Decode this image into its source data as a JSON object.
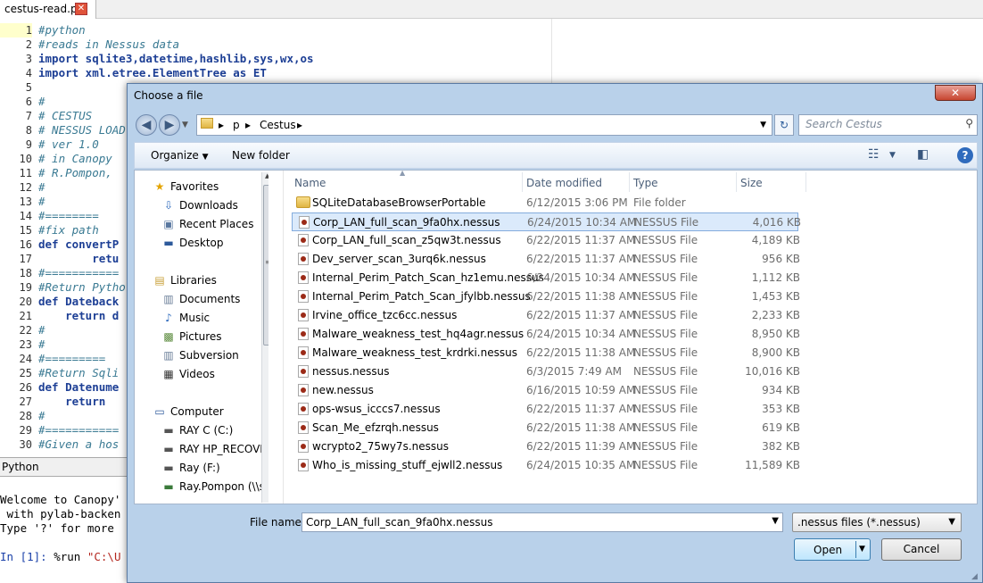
{
  "editor": {
    "tab_label": "cestus-read.py",
    "close_glyph": "✕",
    "lines": [
      {
        "n": "1",
        "text": "#python",
        "kind": "cm"
      },
      {
        "n": "2",
        "text": "#reads in Nessus data",
        "kind": "cm"
      },
      {
        "n": "3",
        "text": "import sqlite3,datetime,hashlib,sys,wx,os",
        "kind": "kw"
      },
      {
        "n": "4",
        "text": "import xml.etree.ElementTree as ET",
        "kind": "kw"
      },
      {
        "n": "5",
        "text": "",
        "kind": "cm"
      },
      {
        "n": "6",
        "text": "#",
        "kind": "cm"
      },
      {
        "n": "7",
        "text": "# CESTUS",
        "kind": "cm"
      },
      {
        "n": "8",
        "text": "# NESSUS LOAD",
        "kind": "cm"
      },
      {
        "n": "9",
        "text": "# ver 1.0",
        "kind": "cm"
      },
      {
        "n": "10",
        "text": "# in Canopy",
        "kind": "cm"
      },
      {
        "n": "11",
        "text": "# R.Pompon,",
        "kind": "cm"
      },
      {
        "n": "12",
        "text": "#",
        "kind": "cm"
      },
      {
        "n": "13",
        "text": "#",
        "kind": "cm"
      },
      {
        "n": "14",
        "text": "#========",
        "kind": "cm"
      },
      {
        "n": "15",
        "text": "#fix path",
        "kind": "cm"
      },
      {
        "n": "16",
        "text": "def convertP",
        "kind": "kw"
      },
      {
        "n": "17",
        "text": "        retu",
        "kind": "kw"
      },
      {
        "n": "18",
        "text": "#===========",
        "kind": "cm"
      },
      {
        "n": "19",
        "text": "#Return Pytho",
        "kind": "cm"
      },
      {
        "n": "20",
        "text": "def Dateback",
        "kind": "kw"
      },
      {
        "n": "21",
        "text": "    return d",
        "kind": "kw"
      },
      {
        "n": "22",
        "text": "#",
        "kind": "cm"
      },
      {
        "n": "23",
        "text": "#",
        "kind": "cm"
      },
      {
        "n": "24",
        "text": "#=========",
        "kind": "cm"
      },
      {
        "n": "25",
        "text": "#Return Sqli",
        "kind": "cm"
      },
      {
        "n": "26",
        "text": "def Datenume",
        "kind": "kw"
      },
      {
        "n": "27",
        "text": "    return",
        "kind": "kw"
      },
      {
        "n": "28",
        "text": "#",
        "kind": "cm"
      },
      {
        "n": "29",
        "text": "#===========",
        "kind": "cm"
      },
      {
        "n": "30",
        "text": "#Given a hos",
        "kind": "cm"
      }
    ]
  },
  "console": {
    "tab_label": "Python",
    "line1": "Welcome to Canopy'",
    "line2": " with pylab-backen",
    "line3": "Type '?' for more ",
    "prompt": "In [1]: ",
    "cmd": "%run ",
    "arg": "\"C:\\U"
  },
  "dialog": {
    "title": "Choose a file",
    "close_glyph": "✕",
    "address": {
      "crumb1": "p",
      "crumb2": "Cestus",
      "sep": "▸"
    },
    "search_placeholder": "Search Cestus",
    "toolbar": {
      "organize": "Organize",
      "new_folder": "New folder",
      "help": "?"
    },
    "nav": {
      "favorites": "Favorites",
      "downloads": "Downloads",
      "recent": "Recent Places",
      "desktop": "Desktop",
      "libraries": "Libraries",
      "documents": "Documents",
      "music": "Music",
      "pictures": "Pictures",
      "subversion": "Subversion",
      "videos": "Videos",
      "computer": "Computer",
      "ray_c": "RAY C (C:)",
      "ray_hp": "RAY HP_RECOVE",
      "ray_f": "Ray (F:)",
      "ray_pompon": "Ray.Pompon (\\\\s"
    },
    "columns": {
      "name": "Name",
      "date": "Date modified",
      "type": "Type",
      "size": "Size"
    },
    "files": [
      {
        "name": "SQLiteDatabaseBrowserPortable",
        "date": "6/12/2015 3:06 PM",
        "type": "File folder",
        "size": ""
      },
      {
        "name": "Corp_LAN_full_scan_9fa0hx.nessus",
        "date": "6/24/2015 10:34 AM",
        "type": "NESSUS File",
        "size": "4,016 KB"
      },
      {
        "name": "Corp_LAN_full_scan_z5qw3t.nessus",
        "date": "6/22/2015 11:37 AM",
        "type": "NESSUS File",
        "size": "4,189 KB"
      },
      {
        "name": "Dev_server_scan_3urq6k.nessus",
        "date": "6/22/2015 11:37 AM",
        "type": "NESSUS File",
        "size": "956 KB"
      },
      {
        "name": "Internal_Perim_Patch_Scan_hz1emu.nessus",
        "date": "6/24/2015 10:34 AM",
        "type": "NESSUS File",
        "size": "1,112 KB"
      },
      {
        "name": "Internal_Perim_Patch_Scan_jfylbb.nessus",
        "date": "6/22/2015 11:38 AM",
        "type": "NESSUS File",
        "size": "1,453 KB"
      },
      {
        "name": "Irvine_office_tzc6cc.nessus",
        "date": "6/22/2015 11:37 AM",
        "type": "NESSUS File",
        "size": "2,233 KB"
      },
      {
        "name": "Malware_weakness_test_hq4agr.nessus",
        "date": "6/24/2015 10:34 AM",
        "type": "NESSUS File",
        "size": "8,950 KB"
      },
      {
        "name": "Malware_weakness_test_krdrki.nessus",
        "date": "6/22/2015 11:38 AM",
        "type": "NESSUS File",
        "size": "8,900 KB"
      },
      {
        "name": "nessus.nessus",
        "date": "6/3/2015 7:49 AM",
        "type": "NESSUS File",
        "size": "10,016 KB"
      },
      {
        "name": "new.nessus",
        "date": "6/16/2015 10:59 AM",
        "type": "NESSUS File",
        "size": "934 KB"
      },
      {
        "name": "ops-wsus_icccs7.nessus",
        "date": "6/22/2015 11:37 AM",
        "type": "NESSUS File",
        "size": "353 KB"
      },
      {
        "name": "Scan_Me_efzrqh.nessus",
        "date": "6/22/2015 11:38 AM",
        "type": "NESSUS File",
        "size": "619 KB"
      },
      {
        "name": "wcrypto2_75wy7s.nessus",
        "date": "6/22/2015 11:39 AM",
        "type": "NESSUS File",
        "size": "382 KB"
      },
      {
        "name": "Who_is_missing_stuff_ejwll2.nessus",
        "date": "6/24/2015 10:35 AM",
        "type": "NESSUS File",
        "size": "11,589 KB"
      }
    ],
    "selected_index": 1,
    "file_name_label": "File name:",
    "file_name_value": "Corp_LAN_full_scan_9fa0hx.nessus",
    "filter_value": ".nessus files (*.nessus)",
    "open_label": "Open",
    "cancel_label": "Cancel"
  }
}
